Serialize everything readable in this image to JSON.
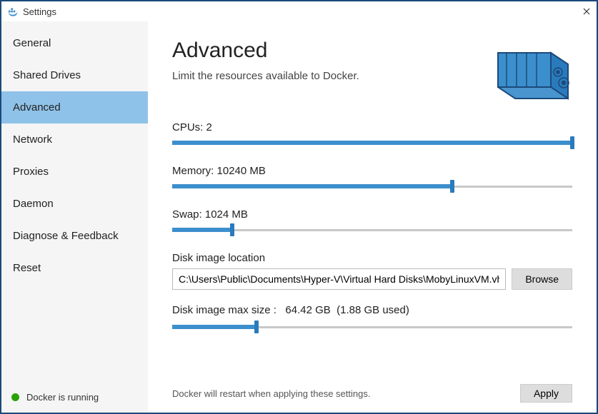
{
  "window": {
    "title": "Settings"
  },
  "sidebar": {
    "items": [
      {
        "label": "General",
        "active": false
      },
      {
        "label": "Shared Drives",
        "active": false
      },
      {
        "label": "Advanced",
        "active": true
      },
      {
        "label": "Network",
        "active": false
      },
      {
        "label": "Proxies",
        "active": false
      },
      {
        "label": "Daemon",
        "active": false
      },
      {
        "label": "Diagnose & Feedback",
        "active": false
      },
      {
        "label": "Reset",
        "active": false
      }
    ]
  },
  "status": {
    "text": "Docker is running",
    "color": "#2aa007"
  },
  "page": {
    "title": "Advanced",
    "subtitle": "Limit the resources available to Docker."
  },
  "sliders": {
    "cpus": {
      "label": "CPUs: 2",
      "percent": 100
    },
    "memory": {
      "label": "Memory: 10240 MB",
      "percent": 70
    },
    "swap": {
      "label": "Swap: 1024 MB",
      "percent": 15
    },
    "disk": {
      "percent": 21
    }
  },
  "disk": {
    "location_label": "Disk image location",
    "path": "C:\\Users\\Public\\Documents\\Hyper-V\\Virtual Hard Disks\\MobyLinuxVM.vhdx",
    "browse": "Browse",
    "size_label": "Disk image max size :",
    "size_value": "64.42 GB",
    "used_value": "(1.88 GB  used)"
  },
  "footer": {
    "note": "Docker will restart when applying these settings.",
    "apply": "Apply"
  }
}
